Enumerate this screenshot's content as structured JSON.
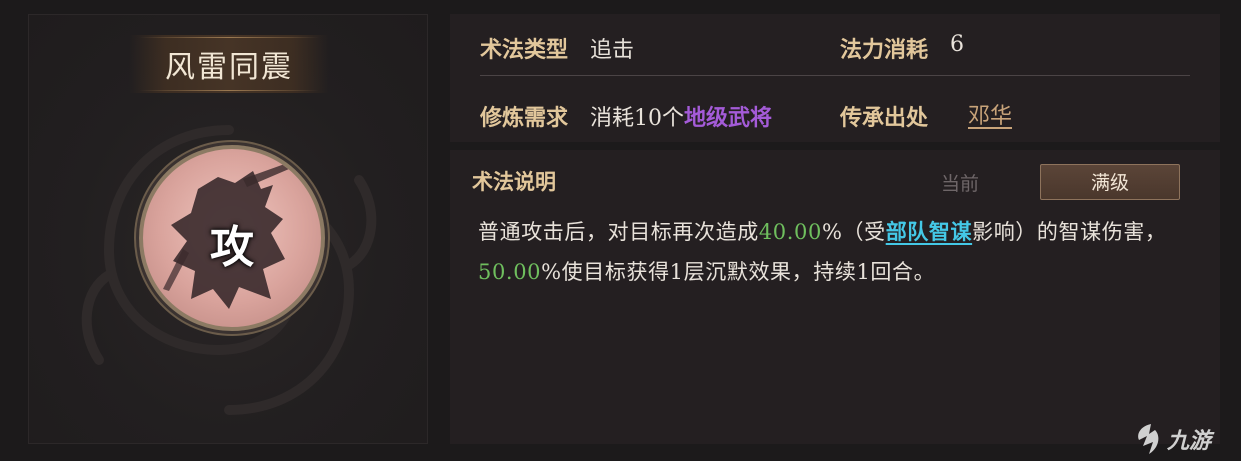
{
  "skill": {
    "name": "风雷同震",
    "type_char": "攻"
  },
  "info": {
    "type_label": "术法类型",
    "type_value": "追击",
    "mana_label": "法力消耗",
    "mana_value": "6",
    "req_label": "修炼需求",
    "req_prefix": "消耗10个",
    "req_highlight": "地级武将",
    "source_label": "传承出处",
    "source_value": "邓华"
  },
  "description": {
    "title": "术法说明",
    "tab_current": "当前",
    "tab_max": "满级",
    "part1": "普通攻击后，对目标再次造成",
    "pct1": "40.00",
    "part2": "%（受",
    "link": "部队智谋",
    "part3": "影响）的智谋伤害，",
    "pct2": "50.00",
    "part4": "%使目标获得1层沉默效果，持续1回合。"
  },
  "watermark": {
    "text": "九游"
  },
  "colors": {
    "gold_label": "#e2c79b",
    "purple": "#a45bd8",
    "green": "#6fbf5e",
    "cyan": "#44c8e6"
  }
}
